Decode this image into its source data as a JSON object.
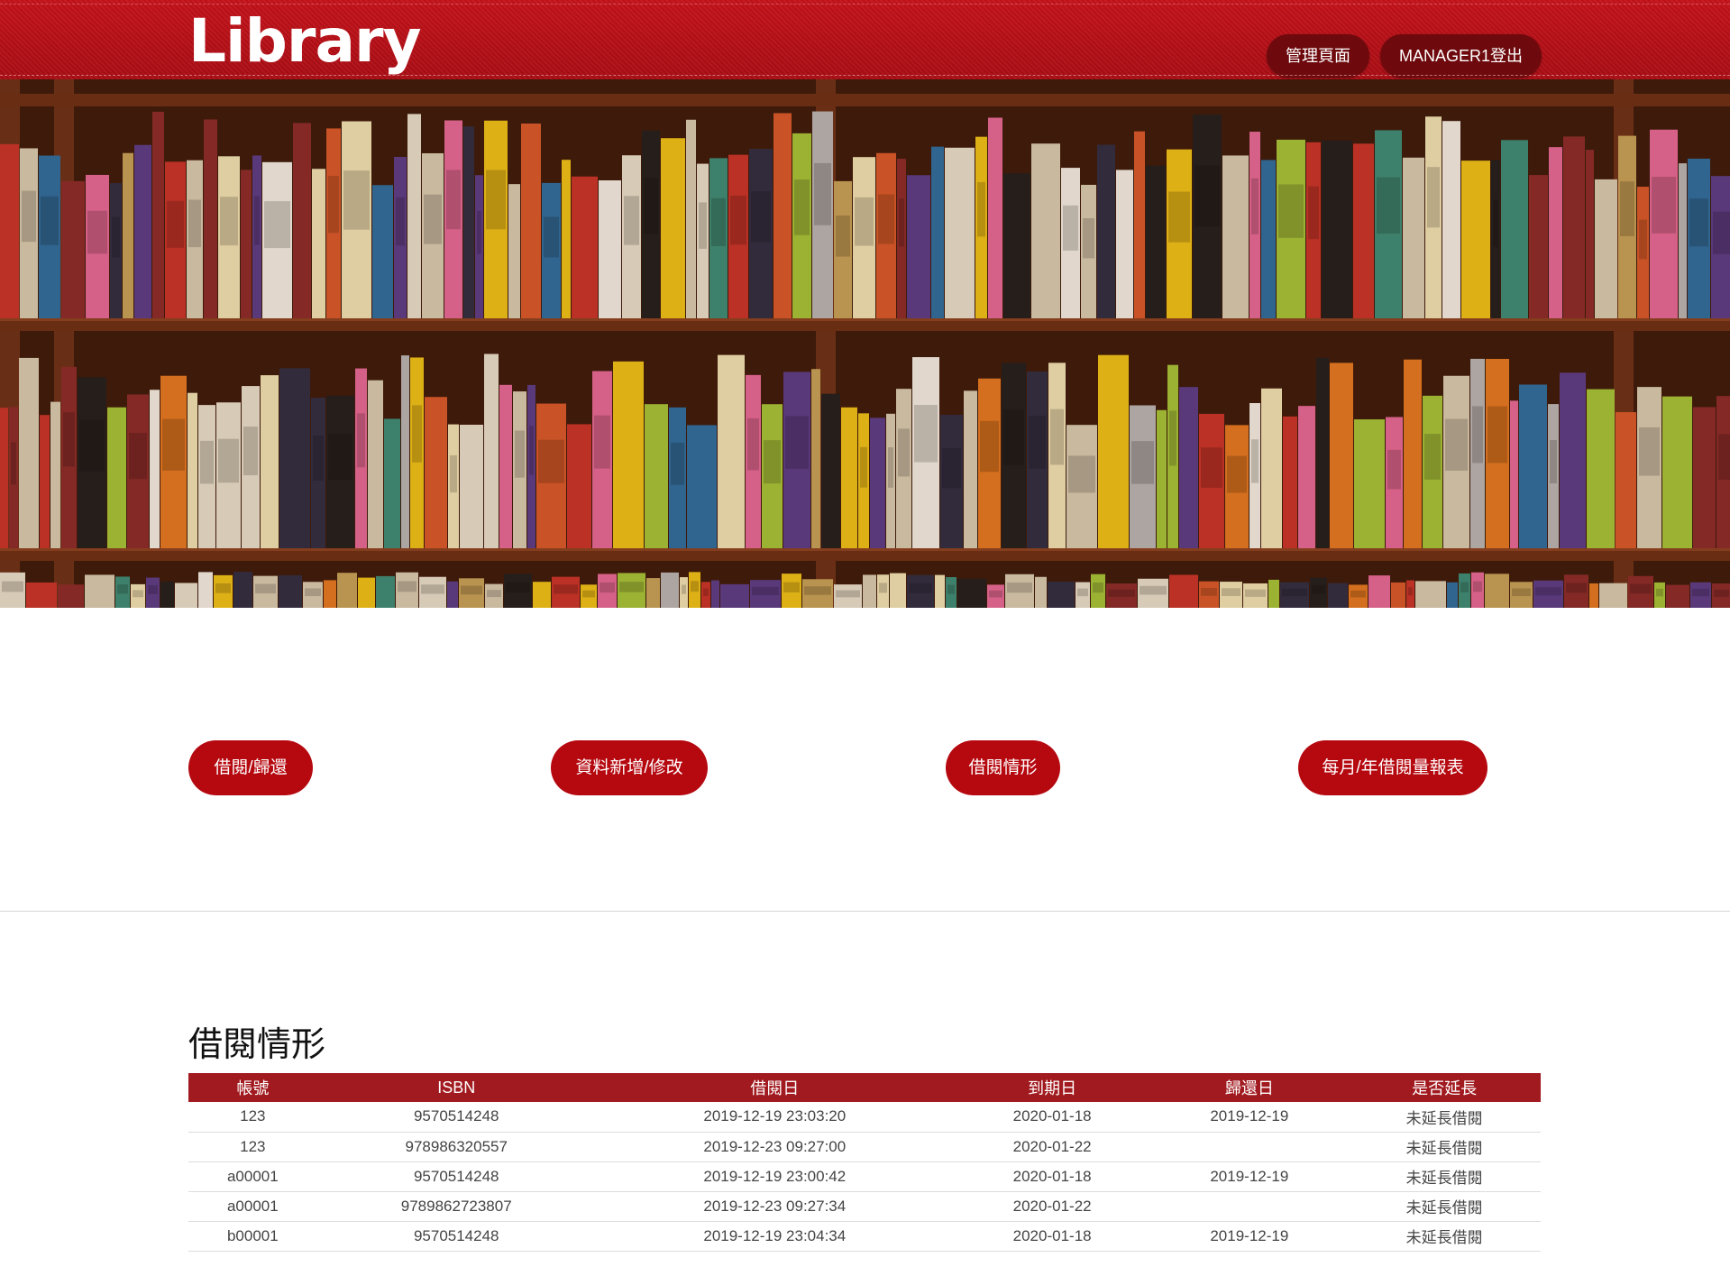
{
  "header": {
    "logo": "Library",
    "nav": [
      {
        "label": "管理頁面"
      },
      {
        "label": "MANAGER1登出"
      }
    ]
  },
  "actions": [
    {
      "label": "借閱/歸還"
    },
    {
      "label": "資料新增/修改"
    },
    {
      "label": "借閱情形"
    },
    {
      "label": "每月/年借閱量報表"
    }
  ],
  "section": {
    "title": "借閱情形",
    "columns": [
      "帳號",
      "ISBN",
      "借閱日",
      "到期日",
      "歸還日",
      "是否延長"
    ],
    "rows": [
      [
        "123",
        "9570514248",
        "2019-12-19 23:03:20",
        "2020-01-18",
        "2019-12-19",
        "未延長借閱"
      ],
      [
        "123",
        "978986320557",
        "2019-12-23 09:27:00",
        "2020-01-22",
        "",
        "未延長借閱"
      ],
      [
        "a00001",
        "9570514248",
        "2019-12-19 23:00:42",
        "2020-01-18",
        "2019-12-19",
        "未延長借閱"
      ],
      [
        "a00001",
        "9789862723807",
        "2019-12-23 09:27:34",
        "2020-01-22",
        "",
        "未延長借閱"
      ],
      [
        "b00001",
        "9570514248",
        "2019-12-19 23:04:34",
        "2020-01-18",
        "2019-12-19",
        "未延長借閱"
      ]
    ]
  },
  "colors": {
    "header_red": "#b5080f",
    "nav_button": "#6e0a0d",
    "table_header": "#a11a1f",
    "shelf_wood": "#5a2a14"
  }
}
